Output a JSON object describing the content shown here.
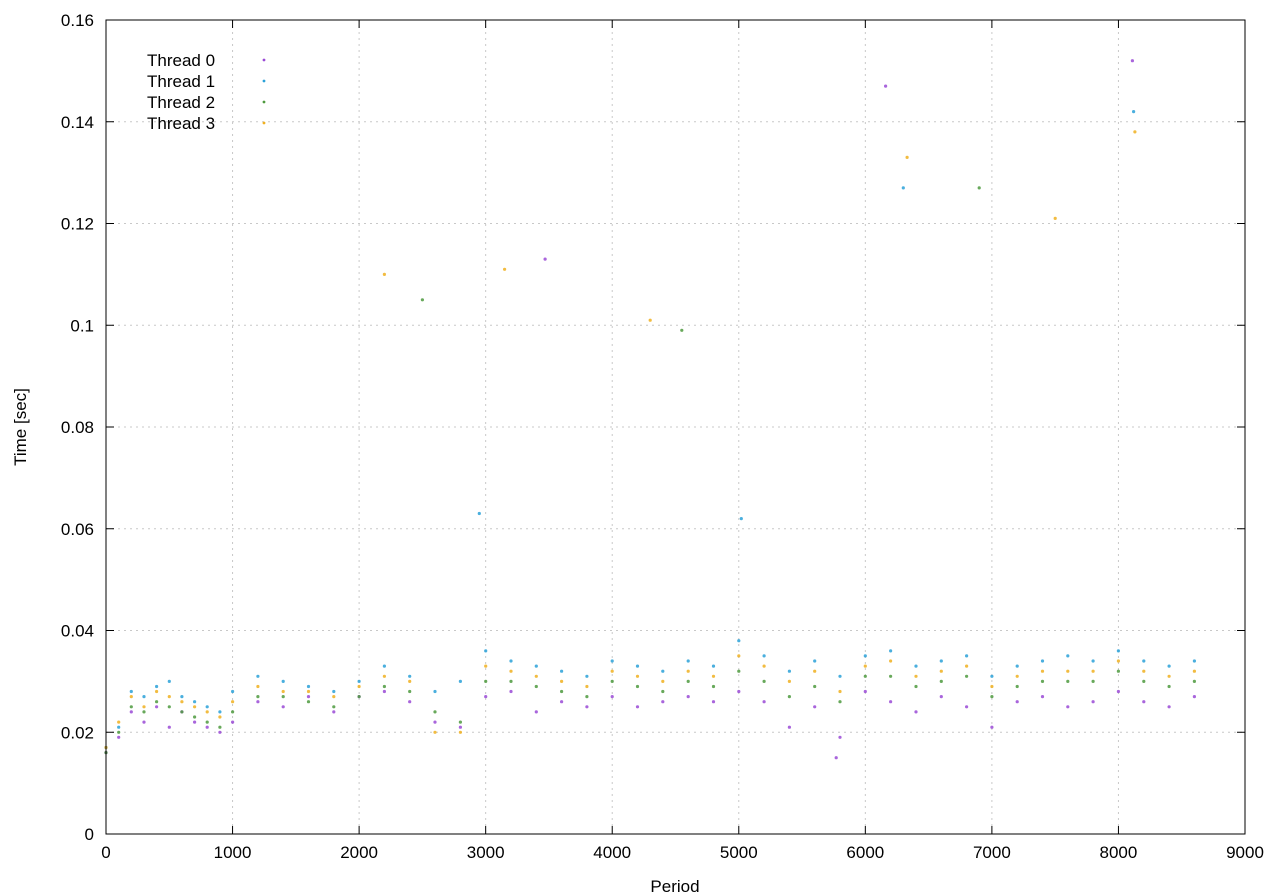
{
  "chart_data": {
    "type": "scatter",
    "title": "",
    "xlabel": "Period",
    "ylabel": "Time [sec]",
    "xlim": [
      0,
      9000
    ],
    "ylim": [
      0,
      0.16
    ],
    "x_ticks": [
      0,
      1000,
      2000,
      3000,
      4000,
      5000,
      6000,
      7000,
      8000,
      9000
    ],
    "y_ticks": [
      0,
      0.02,
      0.04,
      0.06,
      0.08,
      0.1,
      0.12,
      0.14,
      0.16
    ],
    "x_tick_labels": [
      "0",
      "1000",
      "2000",
      "3000",
      "4000",
      "5000",
      "6000",
      "7000",
      "8000",
      "9000"
    ],
    "y_tick_labels": [
      "0",
      "0.02",
      "0.04",
      "0.06",
      "0.08",
      "0.1",
      "0.12",
      "0.14",
      "0.16"
    ],
    "grid": true,
    "legend": "top-left",
    "series": [
      {
        "name": "Thread 0",
        "color": "#9a4ad6",
        "x": [
          0,
          100,
          200,
          300,
          400,
          500,
          600,
          700,
          800,
          900,
          1000,
          1200,
          1400,
          1600,
          1800,
          2000,
          2200,
          2400,
          2600,
          2800,
          3000,
          3200,
          3400,
          3600,
          3800,
          4000,
          4200,
          4400,
          4600,
          4800,
          5000,
          5200,
          5400,
          5600,
          5800,
          6000,
          6200,
          6400,
          6600,
          6800,
          7000,
          7200,
          7400,
          7600,
          7800,
          8000,
          8200,
          8400,
          8600,
          5770,
          3470,
          8110,
          6160
        ],
        "y": [
          0.016,
          0.019,
          0.024,
          0.022,
          0.025,
          0.021,
          0.024,
          0.022,
          0.021,
          0.02,
          0.022,
          0.026,
          0.025,
          0.027,
          0.024,
          0.027,
          0.028,
          0.026,
          0.022,
          0.021,
          0.027,
          0.028,
          0.024,
          0.026,
          0.025,
          0.027,
          0.025,
          0.026,
          0.027,
          0.026,
          0.028,
          0.026,
          0.021,
          0.025,
          0.019,
          0.028,
          0.026,
          0.024,
          0.027,
          0.025,
          0.021,
          0.026,
          0.027,
          0.025,
          0.026,
          0.028,
          0.026,
          0.025,
          0.027,
          0.015,
          0.113,
          0.152,
          0.147
        ]
      },
      {
        "name": "Thread 1",
        "color": "#2aa1d8",
        "x": [
          0,
          100,
          200,
          300,
          400,
          500,
          600,
          700,
          800,
          900,
          1000,
          1200,
          1400,
          1600,
          1800,
          2000,
          2200,
          2400,
          2600,
          2800,
          3000,
          3200,
          3400,
          3600,
          3800,
          4000,
          4200,
          4400,
          4600,
          4800,
          5000,
          5200,
          5400,
          5600,
          5800,
          6000,
          6200,
          6400,
          6600,
          6800,
          7000,
          7200,
          7400,
          7600,
          7800,
          8000,
          8200,
          8400,
          8600,
          2950,
          5020,
          6300,
          8120
        ],
        "y": [
          0.017,
          0.021,
          0.028,
          0.027,
          0.029,
          0.03,
          0.027,
          0.026,
          0.025,
          0.024,
          0.028,
          0.031,
          0.03,
          0.029,
          0.028,
          0.03,
          0.033,
          0.031,
          0.028,
          0.03,
          0.036,
          0.034,
          0.033,
          0.032,
          0.031,
          0.034,
          0.033,
          0.032,
          0.034,
          0.033,
          0.038,
          0.035,
          0.032,
          0.034,
          0.031,
          0.035,
          0.036,
          0.033,
          0.034,
          0.035,
          0.031,
          0.033,
          0.034,
          0.035,
          0.034,
          0.036,
          0.034,
          0.033,
          0.034,
          0.063,
          0.062,
          0.127,
          0.142
        ]
      },
      {
        "name": "Thread 2",
        "color": "#4e9a3e",
        "x": [
          0,
          100,
          200,
          300,
          400,
          500,
          600,
          700,
          800,
          900,
          1000,
          1200,
          1400,
          1600,
          1800,
          2000,
          2200,
          2400,
          2600,
          2800,
          3000,
          3200,
          3400,
          3600,
          3800,
          4000,
          4200,
          4400,
          4600,
          4800,
          5000,
          5200,
          5400,
          5600,
          5800,
          6000,
          6200,
          6400,
          6600,
          6800,
          7000,
          7200,
          7400,
          7600,
          7800,
          8000,
          8200,
          8400,
          8600,
          2500,
          4550,
          6900
        ],
        "y": [
          0.016,
          0.02,
          0.025,
          0.024,
          0.026,
          0.025,
          0.024,
          0.023,
          0.022,
          0.021,
          0.024,
          0.027,
          0.027,
          0.026,
          0.025,
          0.027,
          0.029,
          0.028,
          0.024,
          0.022,
          0.03,
          0.03,
          0.029,
          0.028,
          0.027,
          0.03,
          0.029,
          0.028,
          0.03,
          0.029,
          0.032,
          0.03,
          0.027,
          0.029,
          0.026,
          0.031,
          0.031,
          0.029,
          0.03,
          0.031,
          0.027,
          0.029,
          0.03,
          0.03,
          0.03,
          0.032,
          0.03,
          0.029,
          0.03,
          0.105,
          0.099,
          0.127
        ]
      },
      {
        "name": "Thread 3",
        "color": "#f0b020",
        "x": [
          0,
          100,
          200,
          300,
          400,
          500,
          600,
          700,
          800,
          900,
          1000,
          1200,
          1400,
          1600,
          1800,
          2000,
          2200,
          2400,
          2600,
          2800,
          3000,
          3200,
          3400,
          3600,
          3800,
          4000,
          4200,
          4400,
          4600,
          4800,
          5000,
          5200,
          5400,
          5600,
          5800,
          6000,
          6200,
          6400,
          6600,
          6800,
          7000,
          7200,
          7400,
          7600,
          7800,
          8000,
          8200,
          8400,
          8600,
          2200,
          3150,
          4300,
          6330,
          7500,
          8130
        ],
        "y": [
          0.017,
          0.022,
          0.027,
          0.025,
          0.028,
          0.027,
          0.026,
          0.025,
          0.024,
          0.023,
          0.026,
          0.029,
          0.028,
          0.028,
          0.027,
          0.029,
          0.031,
          0.03,
          0.02,
          0.02,
          0.033,
          0.032,
          0.031,
          0.03,
          0.029,
          0.032,
          0.031,
          0.03,
          0.032,
          0.031,
          0.035,
          0.033,
          0.03,
          0.032,
          0.028,
          0.033,
          0.034,
          0.031,
          0.032,
          0.033,
          0.029,
          0.031,
          0.032,
          0.032,
          0.032,
          0.034,
          0.032,
          0.031,
          0.032,
          0.11,
          0.111,
          0.101,
          0.133,
          0.121,
          0.138
        ]
      }
    ]
  }
}
